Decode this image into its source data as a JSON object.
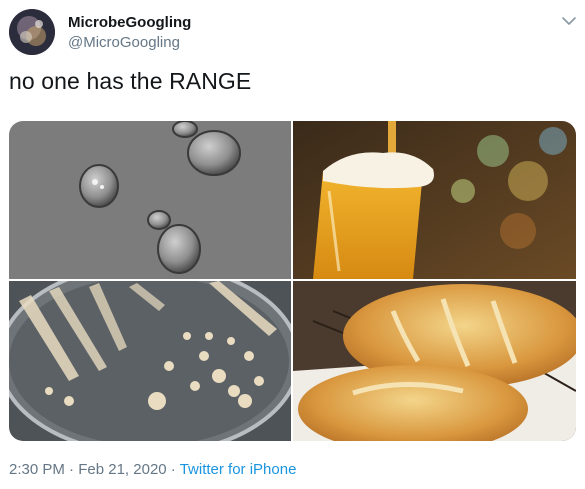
{
  "author": {
    "display_name": "MicrobeGoogling",
    "handle": "@MicroGoogling"
  },
  "tweet": {
    "text": "no one has the RANGE"
  },
  "media": {
    "images": [
      {
        "subject": "yeast cells under microscope"
      },
      {
        "subject": "glass of beer being poured"
      },
      {
        "subject": "yeast colonies on agar plate"
      },
      {
        "subject": "loaves of bread"
      }
    ]
  },
  "meta": {
    "time": "2:30 PM",
    "sep1": " · ",
    "date": "Feb 21, 2020",
    "sep2": " · ",
    "source": "Twitter for iPhone"
  },
  "icons": {
    "menu": "chevron-down-icon"
  },
  "colors": {
    "link": "#1b95e0",
    "secondary_text": "#657786",
    "primary_text": "#14171a"
  }
}
